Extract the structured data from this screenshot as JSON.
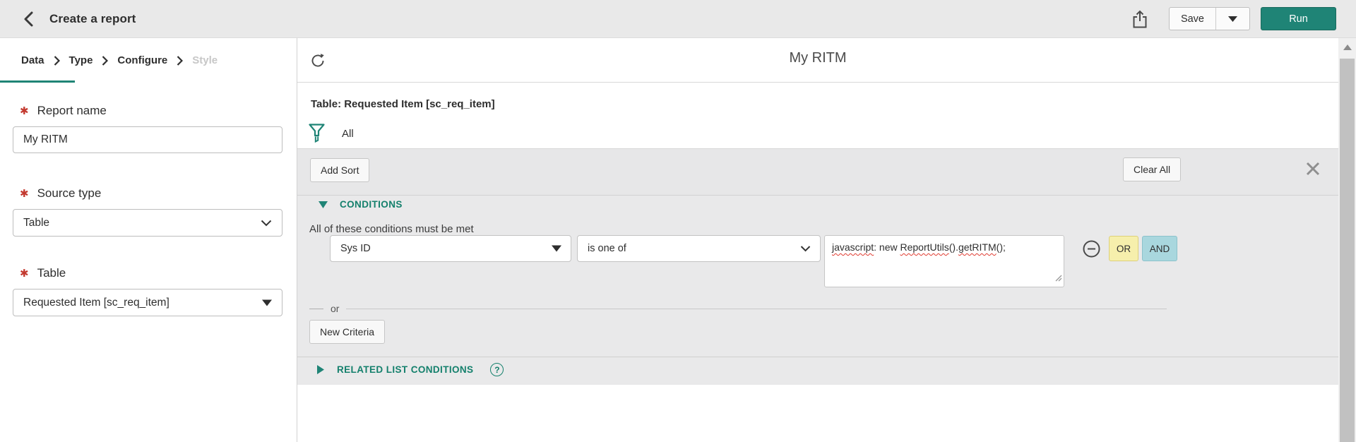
{
  "topbar": {
    "title": "Create a report",
    "save_label": "Save",
    "run_label": "Run"
  },
  "wizard": {
    "steps": [
      {
        "label": "Data",
        "state": "active"
      },
      {
        "label": "Type",
        "state": "enabled"
      },
      {
        "label": "Configure",
        "state": "enabled"
      },
      {
        "label": "Style",
        "state": "disabled"
      }
    ]
  },
  "form": {
    "required_marker": "✱",
    "report_name": {
      "label": "Report name",
      "value": "My RITM",
      "required": true
    },
    "source_type": {
      "label": "Source type",
      "value": "Table",
      "required": true
    },
    "table": {
      "label": "Table",
      "value": "Requested Item [sc_req_item]",
      "required": true
    }
  },
  "main": {
    "title": "My RITM",
    "table_caption": "Table: Requested Item [sc_req_item]",
    "filter_summary": "All",
    "toolbar": {
      "add_sort_label": "Add Sort",
      "clear_all_label": "Clear All"
    },
    "conditions": {
      "section_label": "CONDITIONS",
      "intro": "All of these conditions must be met",
      "row": {
        "field": "Sys ID",
        "operator": "is one of",
        "value_full": "javascript: new ReportUtils().getRITM();",
        "value_segments": [
          {
            "text": "javascript",
            "misspelled": true
          },
          {
            "text": ": new ",
            "misspelled": false
          },
          {
            "text": "ReportUtils",
            "misspelled": true
          },
          {
            "text": "().",
            "misspelled": false
          },
          {
            "text": "getRITM",
            "misspelled": true
          },
          {
            "text": "();",
            "misspelled": false
          }
        ],
        "or_label": "OR",
        "and_label": "AND"
      },
      "or_divider_label": "or",
      "new_criteria_label": "New Criteria"
    },
    "related": {
      "section_label": "RELATED LIST CONDITIONS",
      "help_glyph": "?"
    }
  },
  "icons": {
    "back": "chevron-left",
    "share": "export-arrow-up",
    "save_caret": "caret-down",
    "refresh": "refresh-circular-arrow",
    "filter": "funnel",
    "field_caret": "triangle-down",
    "operator_caret": "chevron-down",
    "remove_condition": "minus-circle",
    "close": "x-mark",
    "conditions_caret": "triangle-down",
    "related_caret": "triangle-right",
    "help": "question-circle",
    "scroll_up": "triangle-up"
  },
  "colors": {
    "accent_teal": "#1f8476",
    "teal_text": "#14806c",
    "topbar_bg": "#e9e9e9",
    "panel_bg": "#e9e9ea",
    "toolbar_bg": "#e7e7e8",
    "required_red": "#c3392f",
    "squiggle_red": "#e03b30",
    "or_chip_bg": "#f6efac",
    "and_chip_bg": "#a9d7de",
    "scroll_thumb": "#c1c1c1"
  }
}
